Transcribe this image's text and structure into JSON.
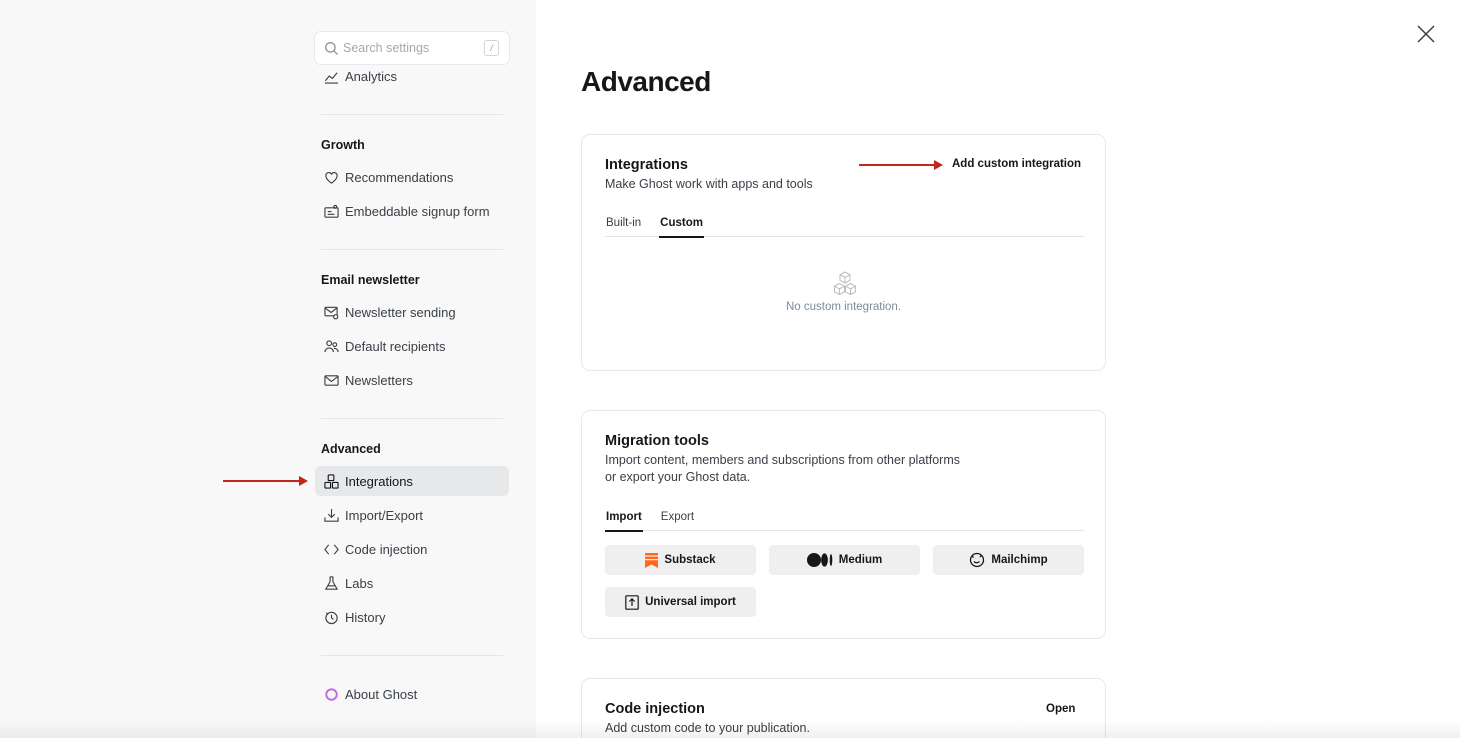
{
  "search": {
    "placeholder": "Search settings",
    "shortcut": "/"
  },
  "sidebar": {
    "top_item": {
      "label": "Analytics",
      "icon": "analytics-icon"
    },
    "groups": [
      {
        "title": "Growth",
        "items": [
          {
            "label": "Recommendations",
            "icon": "heart-icon"
          },
          {
            "label": "Embeddable signup form",
            "icon": "signup-form-icon"
          }
        ]
      },
      {
        "title": "Email newsletter",
        "items": [
          {
            "label": "Newsletter sending",
            "icon": "mail-settings-icon"
          },
          {
            "label": "Default recipients",
            "icon": "users-icon"
          },
          {
            "label": "Newsletters",
            "icon": "envelope-icon"
          }
        ]
      },
      {
        "title": "Advanced",
        "items": [
          {
            "label": "Integrations",
            "icon": "integrations-icon",
            "active": true
          },
          {
            "label": "Import/Export",
            "icon": "download-icon"
          },
          {
            "label": "Code injection",
            "icon": "code-icon"
          },
          {
            "label": "Labs",
            "icon": "flask-icon"
          },
          {
            "label": "History",
            "icon": "history-icon"
          }
        ]
      }
    ],
    "about": {
      "label": "About Ghost",
      "icon": "ghost-ring-icon"
    }
  },
  "main": {
    "title": "Advanced",
    "integrations": {
      "title": "Integrations",
      "description": "Make Ghost work with apps and tools",
      "action": "Add custom integration",
      "tabs": [
        {
          "label": "Built-in"
        },
        {
          "label": "Custom",
          "active": true
        }
      ],
      "empty_text": "No custom integration."
    },
    "migration": {
      "title": "Migration tools",
      "description_line1": "Import content, members and subscriptions from other platforms",
      "description_line2": "or export your Ghost data.",
      "tabs": [
        {
          "label": "Import",
          "active": true
        },
        {
          "label": "Export"
        }
      ],
      "buttons": [
        {
          "label": "Substack",
          "icon": "substack-icon"
        },
        {
          "label": "Medium",
          "icon": "medium-icon"
        },
        {
          "label": "Mailchimp",
          "icon": "mailchimp-icon"
        },
        {
          "label": "Universal import",
          "icon": "upload-file-icon"
        }
      ]
    },
    "code_injection": {
      "title": "Code injection",
      "description": "Add custom code to your publication.",
      "action": "Open"
    }
  },
  "colors": {
    "accent_arrow": "#c0271a",
    "substack": "#ff6719",
    "sidebar_bg": "#f8f8f8",
    "active_bg": "#e7e8ea"
  }
}
